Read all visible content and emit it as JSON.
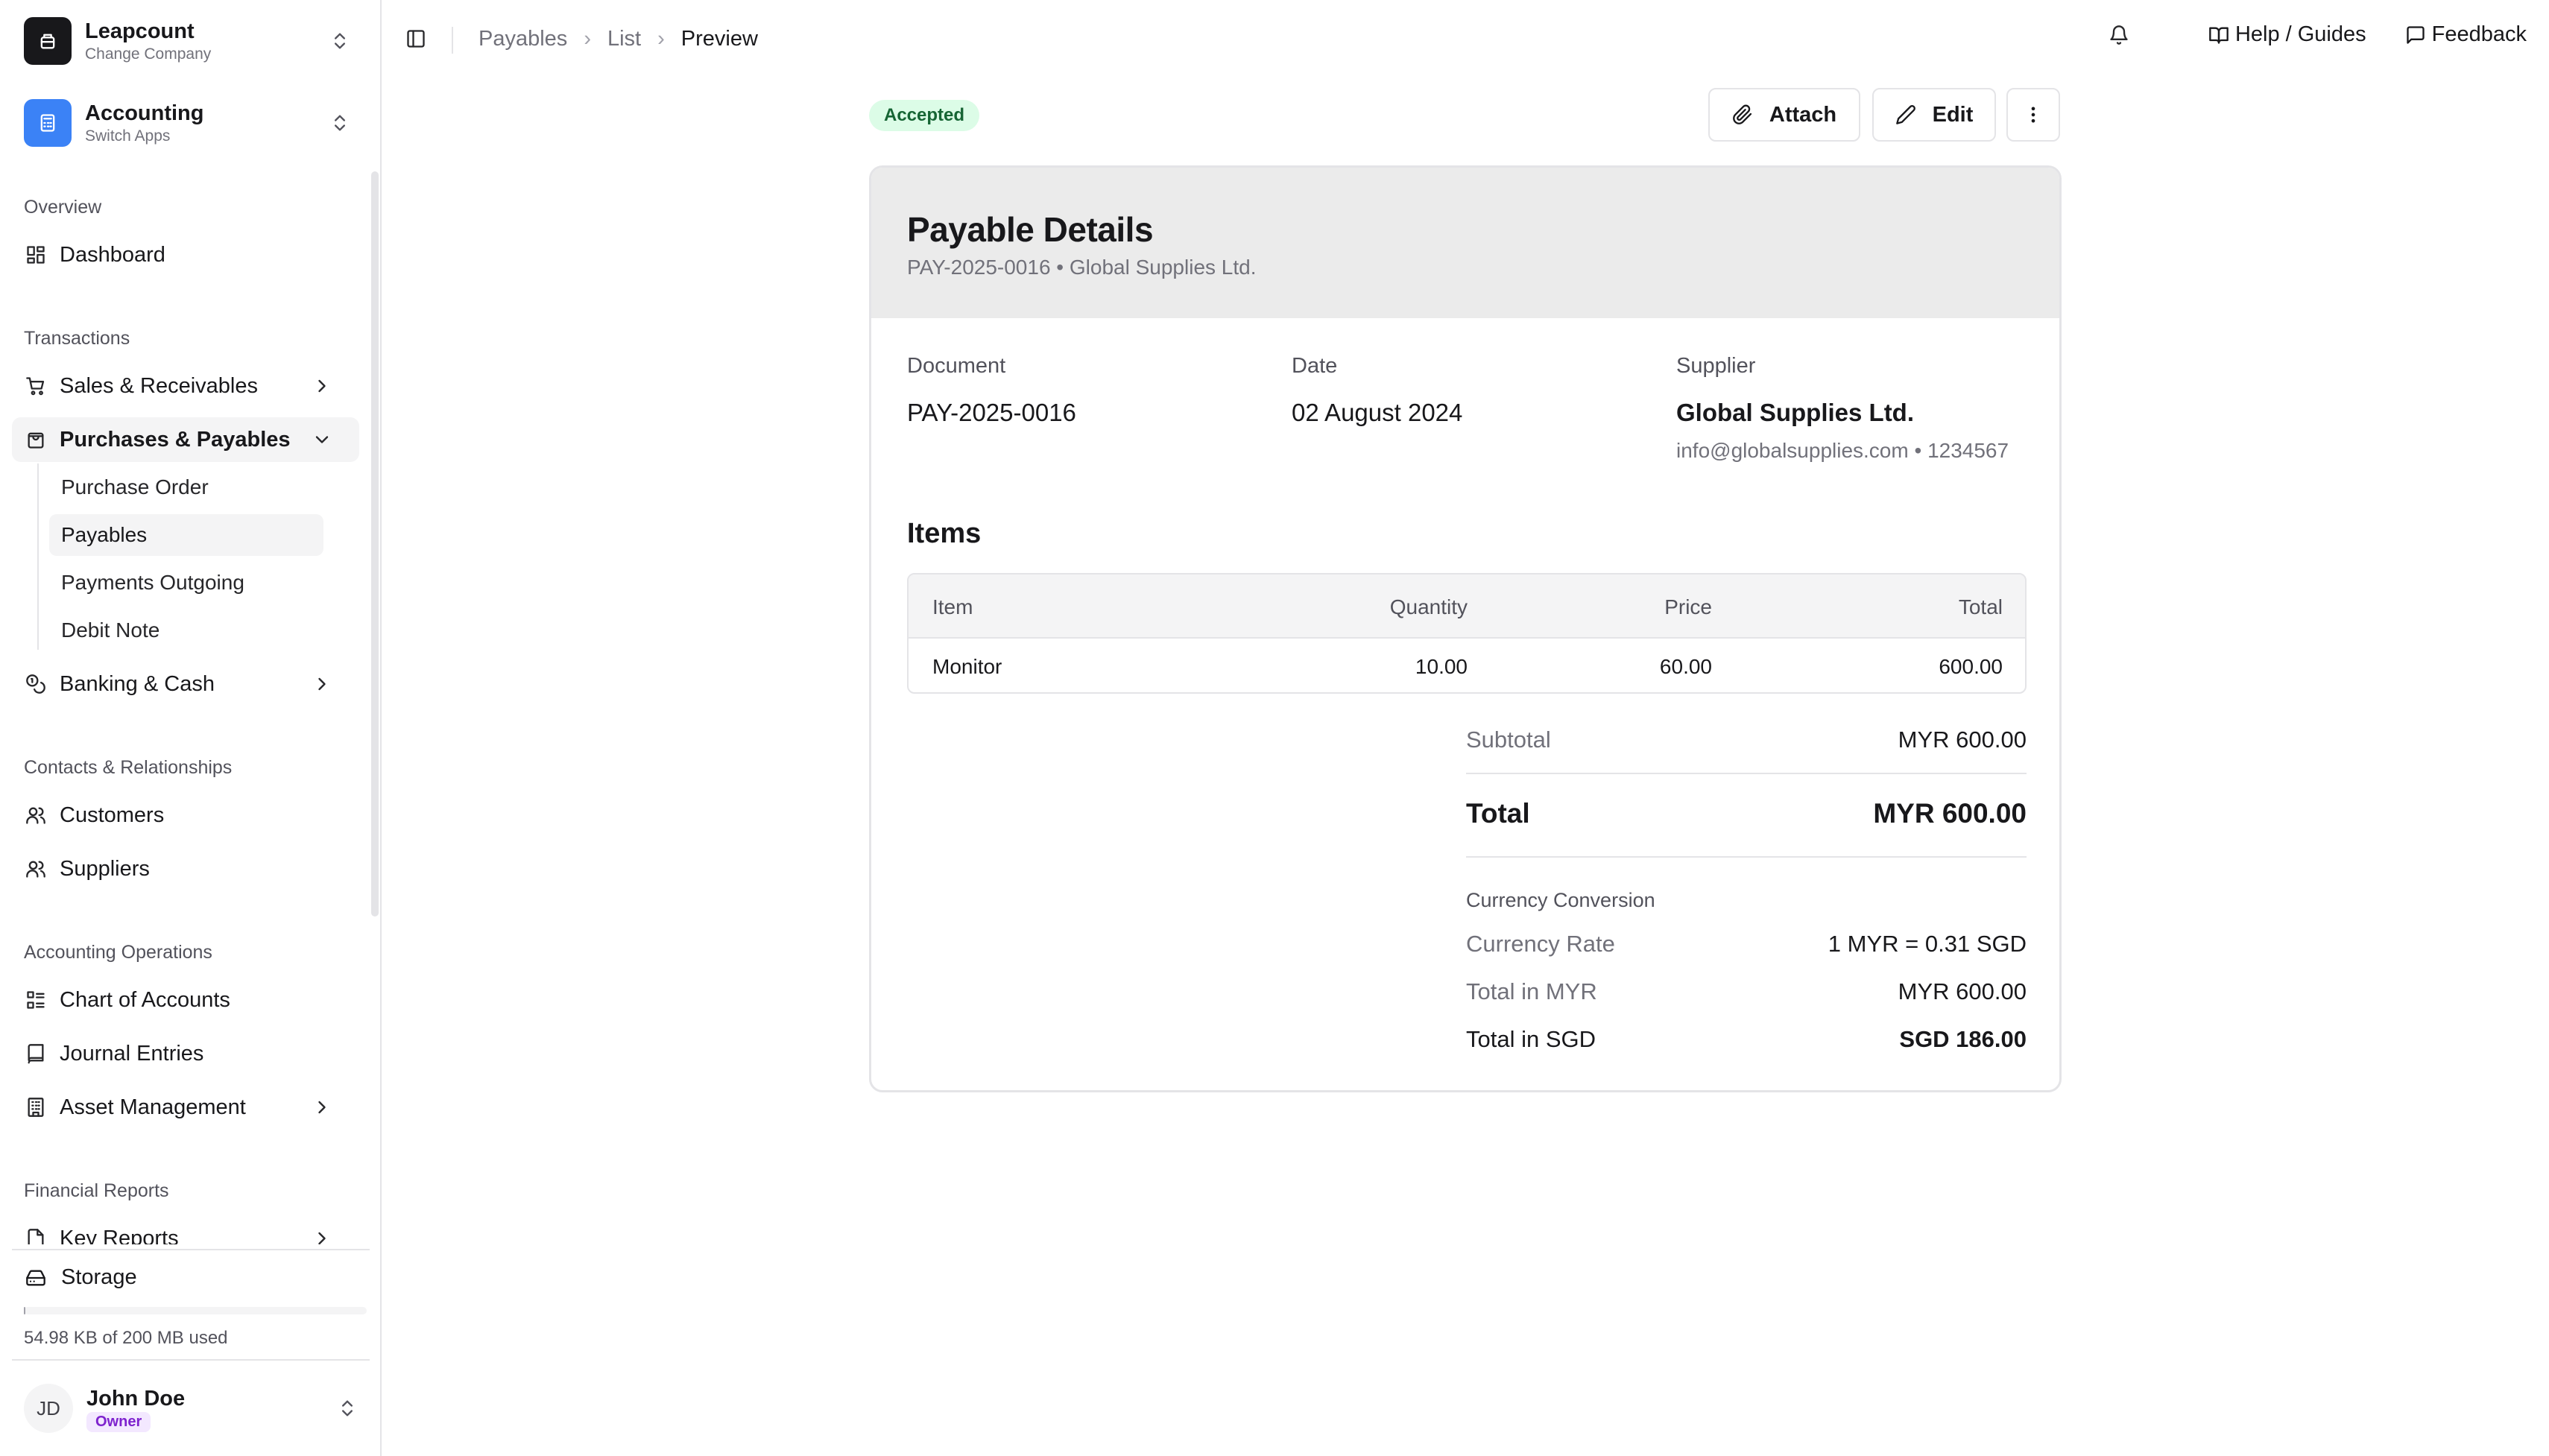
{
  "company": {
    "name": "Leapcount",
    "sub": "Change Company"
  },
  "app": {
    "name": "Accounting",
    "sub": "Switch Apps"
  },
  "nav": {
    "overview_label": "Overview",
    "dashboard": "Dashboard",
    "transactions_label": "Transactions",
    "sales": "Sales & Receivables",
    "purchases": "Purchases & Payables",
    "purchases_sub": [
      "Purchase Order",
      "Payables",
      "Payments Outgoing",
      "Debit Note"
    ],
    "banking": "Banking & Cash",
    "contacts_label": "Contacts & Relationships",
    "customers": "Customers",
    "suppliers": "Suppliers",
    "accounting_ops_label": "Accounting Operations",
    "chart_of_accounts": "Chart of Accounts",
    "journal_entries": "Journal Entries",
    "asset_management": "Asset Management",
    "financial_reports_label": "Financial Reports",
    "key_reports": "Key Reports"
  },
  "storage": {
    "label": "Storage",
    "used_text": "54.98 KB of 200 MB used",
    "used_fraction": 0.0003
  },
  "user": {
    "initials": "JD",
    "name": "John Doe",
    "role": "Owner"
  },
  "breadcrumb": [
    "Payables",
    "List",
    "Preview"
  ],
  "topbar": {
    "help": "Help / Guides",
    "feedback": "Feedback"
  },
  "status": "Accepted",
  "actions": {
    "attach": "Attach",
    "edit": "Edit"
  },
  "payable": {
    "title": "Payable Details",
    "subtitle": "PAY-2025-0016 • Global Supplies Ltd.",
    "document_label": "Document",
    "document": "PAY-2025-0016",
    "date_label": "Date",
    "date": "02 August 2024",
    "supplier_label": "Supplier",
    "supplier": "Global Supplies Ltd.",
    "supplier_contact": "info@globalsupplies.com • 1234567"
  },
  "items": {
    "title": "Items",
    "columns": [
      "Item",
      "Quantity",
      "Price",
      "Total"
    ],
    "rows": [
      {
        "item": "Monitor",
        "quantity": "10.00",
        "price": "60.00",
        "total": "600.00"
      }
    ]
  },
  "totals": {
    "subtotal_label": "Subtotal",
    "subtotal": "MYR 600.00",
    "total_label": "Total",
    "total": "MYR 600.00",
    "conversion_title": "Currency Conversion",
    "rate_label": "Currency Rate",
    "rate": "1 MYR = 0.31 SGD",
    "total_myr_label": "Total in MYR",
    "total_myr": "MYR 600.00",
    "total_sgd_label": "Total in SGD",
    "total_sgd": "SGD 186.00"
  },
  "colors": {
    "app_icon": "#3b82f6",
    "company_icon": "#18181b",
    "accepted_bg": "#dcfce7",
    "accepted_text": "#166534",
    "owner": "#7e22ce"
  }
}
